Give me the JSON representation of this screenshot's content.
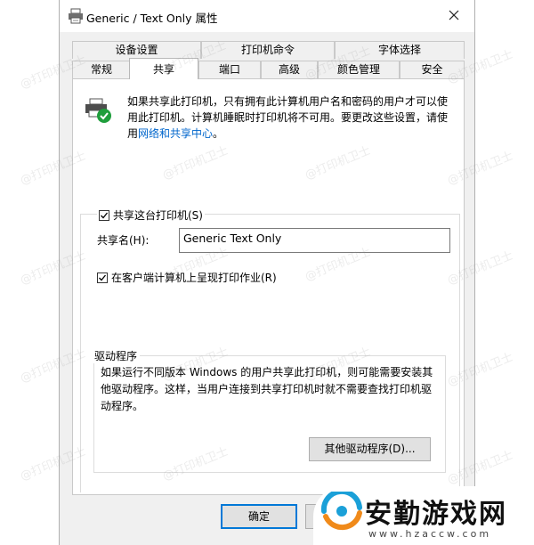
{
  "window": {
    "title": "Generic / Text Only 属性"
  },
  "tabs_back": [
    "设备设置",
    "打印机命令",
    "字体选择"
  ],
  "tabs_front": [
    "常规",
    "共享",
    "端口",
    "高级",
    "颜色管理",
    "安全"
  ],
  "active_tab": "共享",
  "intro": {
    "text": "如果共享此打印机，只有拥有此计算机用户名和密码的用户才可以使用此打印机。计算机睡眠时打印机将不可用。要更改这些设置，请使用",
    "link": "网络和共享中心",
    "suffix": "。"
  },
  "share": {
    "checkbox_label": "共享这台打印机(S)",
    "checked": true,
    "name_label": "共享名(H):",
    "name_value": "Generic  Text Only"
  },
  "render": {
    "checkbox_label": "在客户端计算机上呈现打印作业(R)",
    "checked": true
  },
  "drivers": {
    "legend": "驱动程序",
    "text": "如果运行不同版本 Windows 的用户共享此打印机，则可能需要安装其他驱动程序。这样，当用户连接到共享打印机时就不需要查找打印机驱动程序。",
    "button": "其他驱动程序(D)..."
  },
  "footer": {
    "ok": "确定"
  },
  "watermark": "@打印机卫士",
  "brand": {
    "name": "安勤游戏网",
    "url": "www.hzaccw.com"
  },
  "colors": {
    "accent": "#0078d7",
    "link": "#0066cc",
    "check_green": "#1f9e3c"
  }
}
